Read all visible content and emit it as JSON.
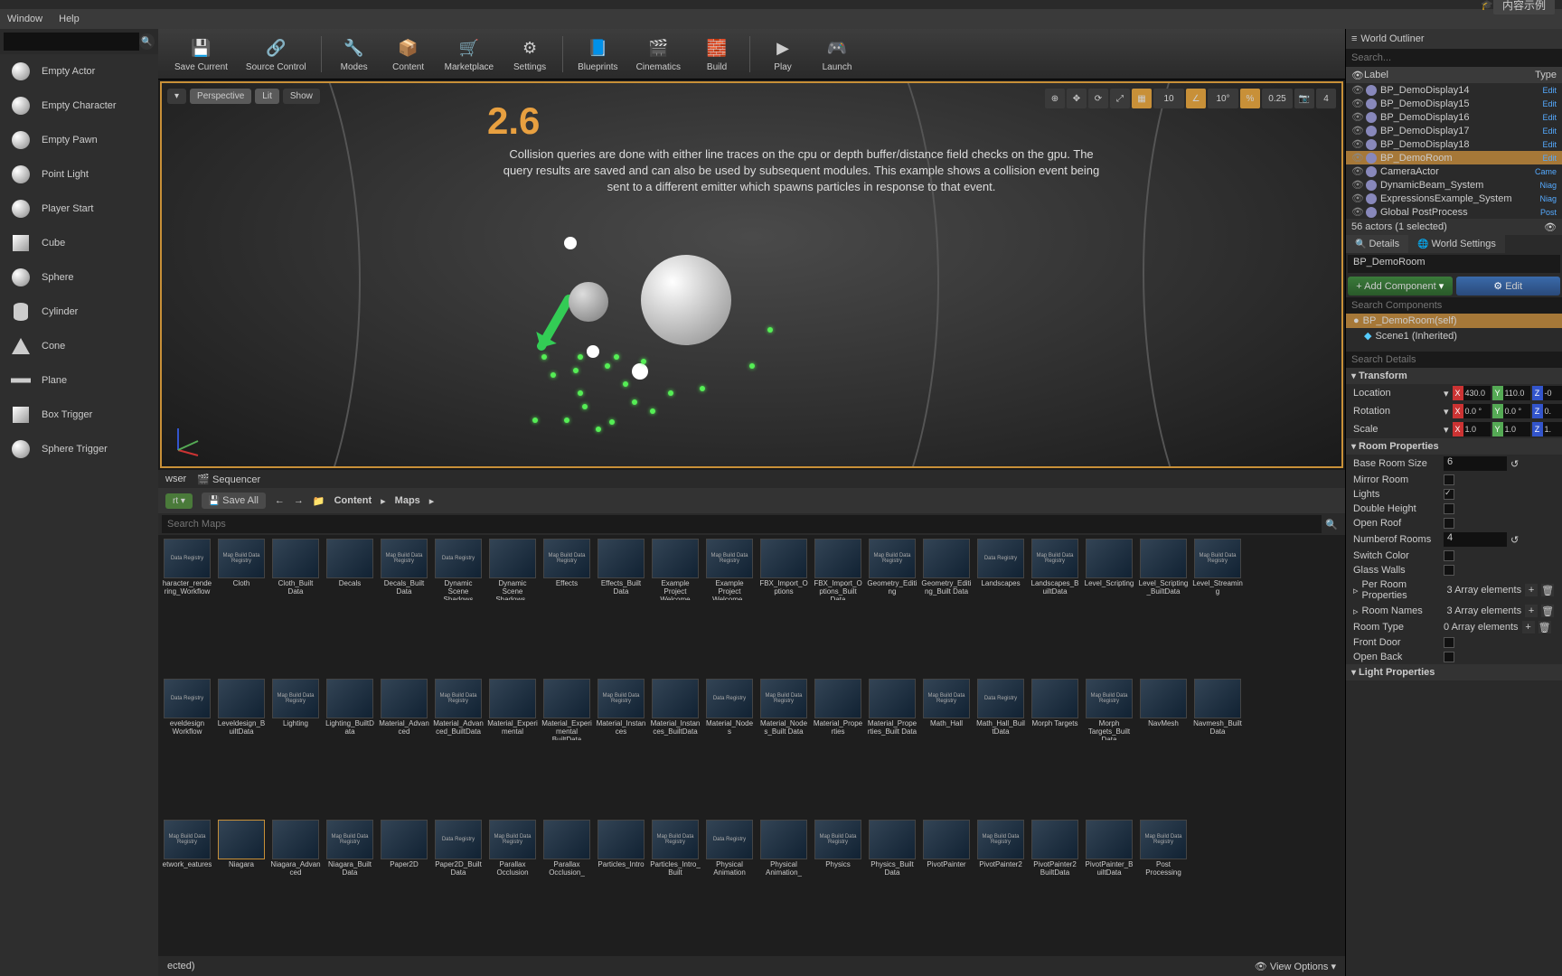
{
  "topbar": {
    "content_example": "内容示例"
  },
  "menubar": {
    "window": "Window",
    "help": "Help"
  },
  "toolbar_items": [
    {
      "label": "Save Current",
      "glyph": "💾"
    },
    {
      "label": "Source Control",
      "glyph": "🔗"
    },
    {
      "label": "Modes",
      "glyph": "🔧"
    },
    {
      "label": "Content",
      "glyph": "📦"
    },
    {
      "label": "Marketplace",
      "glyph": "🛒"
    },
    {
      "label": "Settings",
      "glyph": "⚙"
    },
    {
      "label": "Blueprints",
      "glyph": "📘"
    },
    {
      "label": "Cinematics",
      "glyph": "🎬"
    },
    {
      "label": "Build",
      "glyph": "🧱"
    },
    {
      "label": "Play",
      "glyph": "▶"
    },
    {
      "label": "Launch",
      "glyph": "🎮"
    }
  ],
  "place_actors": {
    "items": [
      "Empty Actor",
      "Empty Character",
      "Empty Pawn",
      "Point Light",
      "Player Start",
      "Cube",
      "Sphere",
      "Cylinder",
      "Cone",
      "Plane",
      "Box Trigger",
      "Sphere Trigger"
    ]
  },
  "viewport": {
    "perspective": "Perspective",
    "lit": "Lit",
    "show": "Show",
    "section": "2.6",
    "desc": "Collision queries are done with either line traces on the cpu or depth buffer/distance field checks on the gpu. The query results are saved and can also be used by subsequent modules. This example shows a collision event being sent to a different emitter which spawns particles in response to that event.",
    "snap_vals": {
      "grid": "10",
      "angle": "10°",
      "scale": "0.25",
      "cam": "4"
    }
  },
  "browser": {
    "tabs": {
      "browser": "wser",
      "sequencer": "Sequencer"
    },
    "save_all": "Save All",
    "content": "Content",
    "maps": "Maps",
    "search_ph": "Search Maps",
    "view_options": "View Options",
    "status": "ected)",
    "thumbs": [
      "haracter_rendering_Workflow",
      "Cloth",
      "Cloth_Built Data",
      "Decals",
      "Decals_Built Data",
      "Dynamic Scene Shadows",
      "Dynamic Scene Shadows_",
      "Effects",
      "Effects_Built Data",
      "Example Project Welcome",
      "Example Project Welcome_",
      "FBX_Import_Options",
      "FBX_Import_Options_Built Data",
      "Geometry_Editing",
      "Geometry_Editing_Built Data",
      "Landscapes",
      "Landscapes_BuiltData",
      "Level_Scripting",
      "Level_Scripting_BuiltData",
      "Level_Streaming",
      "eveldesign Workflow",
      "Leveldesign_BuiltData",
      "Lighting",
      "Lighting_BuiltData",
      "Material_Advanced",
      "Material_Advanced_BuiltData",
      "Material_Experimental",
      "Material_Experimental BuiltData",
      "Material_Instances",
      "Material_Instances_BuiltData",
      "Material_Nodes",
      "Material_Nodes_Built Data",
      "Material_Properties",
      "Material_Properties_Built Data",
      "Math_Hall",
      "Math_Hall_BuiltData",
      "Morph Targets",
      "Morph Targets_Built Data",
      "NavMesh",
      "Navmesh_BuiltData",
      "etwork_eatures",
      "Niagara",
      "Niagara_Advanced",
      "Niagara_Built Data",
      "Paper2D",
      "Paper2D_BuiltData",
      "Parallax Occlusion",
      "Parallax Occlusion_",
      "Particles_Intro",
      "Particles_Intro_Built",
      "Physical Animation",
      "Physical Animation_",
      "Physics",
      "Physics_Built Data",
      "PivotPainter",
      "PivotPainter2",
      "PivotPainter2 BuiltData",
      "PivotPainter_BuiltData",
      "Post Processing"
    ]
  },
  "outliner": {
    "title": "World Outliner",
    "search_ph": "Search...",
    "col_label": "Label",
    "col_type": "Type",
    "rows": [
      {
        "name": "BP_DemoDisplay14",
        "type": "Edit"
      },
      {
        "name": "BP_DemoDisplay15",
        "type": "Edit"
      },
      {
        "name": "BP_DemoDisplay16",
        "type": "Edit"
      },
      {
        "name": "BP_DemoDisplay17",
        "type": "Edit"
      },
      {
        "name": "BP_DemoDisplay18",
        "type": "Edit"
      },
      {
        "name": "BP_DemoRoom",
        "type": "Edit",
        "sel": true
      },
      {
        "name": "CameraActor",
        "type": "Came"
      },
      {
        "name": "DynamicBeam_System",
        "type": "Niag"
      },
      {
        "name": "ExpressionsExample_System",
        "type": "Niag"
      },
      {
        "name": "Global PostProcess",
        "type": "Post"
      }
    ],
    "footer": "56 actors (1 selected)"
  },
  "details": {
    "tab_details": "Details",
    "tab_world": "World Settings",
    "actor_name": "BP_DemoRoom",
    "add_comp": "+ Add Component",
    "edit_bp": "Edit",
    "comp_search_ph": "Search Components",
    "comp_self": "BP_DemoRoom(self)",
    "comp_scene": "Scene1 (Inherited)",
    "det_search_ph": "Search Details",
    "cat_transform": "Transform",
    "loc": "Location",
    "rot": "Rotation",
    "scale": "Scale",
    "loc_x": "430.0",
    "loc_y": "110.0",
    "loc_z": "-0",
    "rot_x": "0.0 °",
    "rot_y": "0.0 °",
    "rot_z": "0.",
    "scl_x": "1.0",
    "scl_y": "1.0",
    "scl_z": "1.",
    "cat_room": "Room Properties",
    "base_room_size": "Base Room Size",
    "base_room_size_v": "6",
    "mirror_room": "Mirror Room",
    "lights": "Lights",
    "double_height": "Double Height",
    "open_roof": "Open Roof",
    "num_rooms": "Numberof Rooms",
    "num_rooms_v": "4",
    "switch_color": "Switch Color",
    "glass_walls": "Glass Walls",
    "per_room": "Per Room Properties",
    "per_room_v": "3 Array elements",
    "room_names": "Room Names",
    "room_names_v": "3 Array elements",
    "room_type": "Room Type",
    "room_type_v": "0 Array elements",
    "front_door": "Front Door",
    "open_back": "Open Back",
    "cat_light": "Light Properties"
  }
}
